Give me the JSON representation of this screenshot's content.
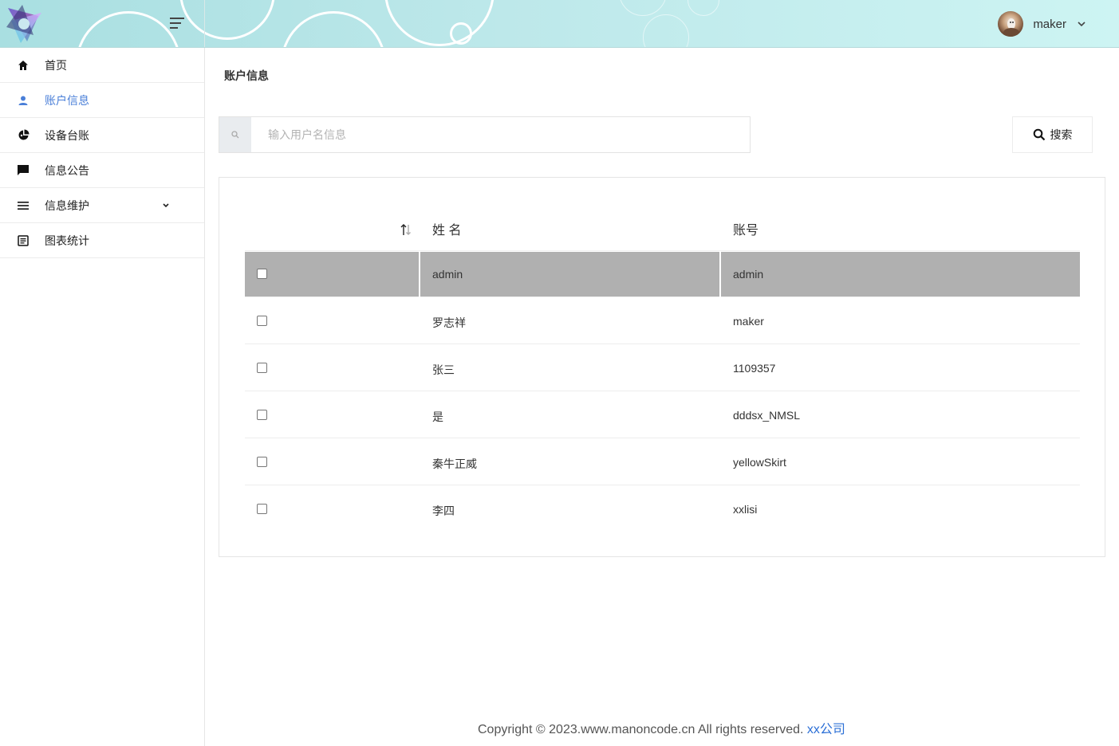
{
  "user": {
    "name": "maker"
  },
  "sidebar": {
    "items": [
      {
        "label": "首页",
        "icon": "home-icon"
      },
      {
        "label": "账户信息",
        "icon": "user-icon",
        "active": true
      },
      {
        "label": "设备台账",
        "icon": "pie-chart-icon"
      },
      {
        "label": "信息公告",
        "icon": "chat-bubble-icon"
      },
      {
        "label": "信息维护",
        "icon": "list-icon",
        "expandable": true
      },
      {
        "label": "图表统计",
        "icon": "document-icon"
      }
    ]
  },
  "main": {
    "title": "账户信息",
    "search": {
      "placeholder": "输入用户名信息",
      "value": "",
      "button_label": "搜索"
    },
    "table": {
      "columns": [
        "姓 名",
        "账号"
      ],
      "rows": [
        {
          "name": "admin",
          "account": "admin",
          "selected": true
        },
        {
          "name": "罗志祥",
          "account": "maker"
        },
        {
          "name": "张三",
          "account": "1109357"
        },
        {
          "name": "是",
          "account": "dddsx_NMSL"
        },
        {
          "name": "秦牛正威",
          "account": "yellowSkirt"
        },
        {
          "name": "李四",
          "account": "xxlisi"
        }
      ]
    }
  },
  "footer": {
    "text": "Copyright © 2023.www.manoncode.cn All rights reserved.",
    "brand": "xx公司"
  },
  "colors": {
    "header_start": "#a9dfe1",
    "header_end": "#cdf4f3",
    "active_nav": "#4a7fd8",
    "selected_row": "#b0b0b0",
    "footer_link": "#2b6fd6"
  }
}
